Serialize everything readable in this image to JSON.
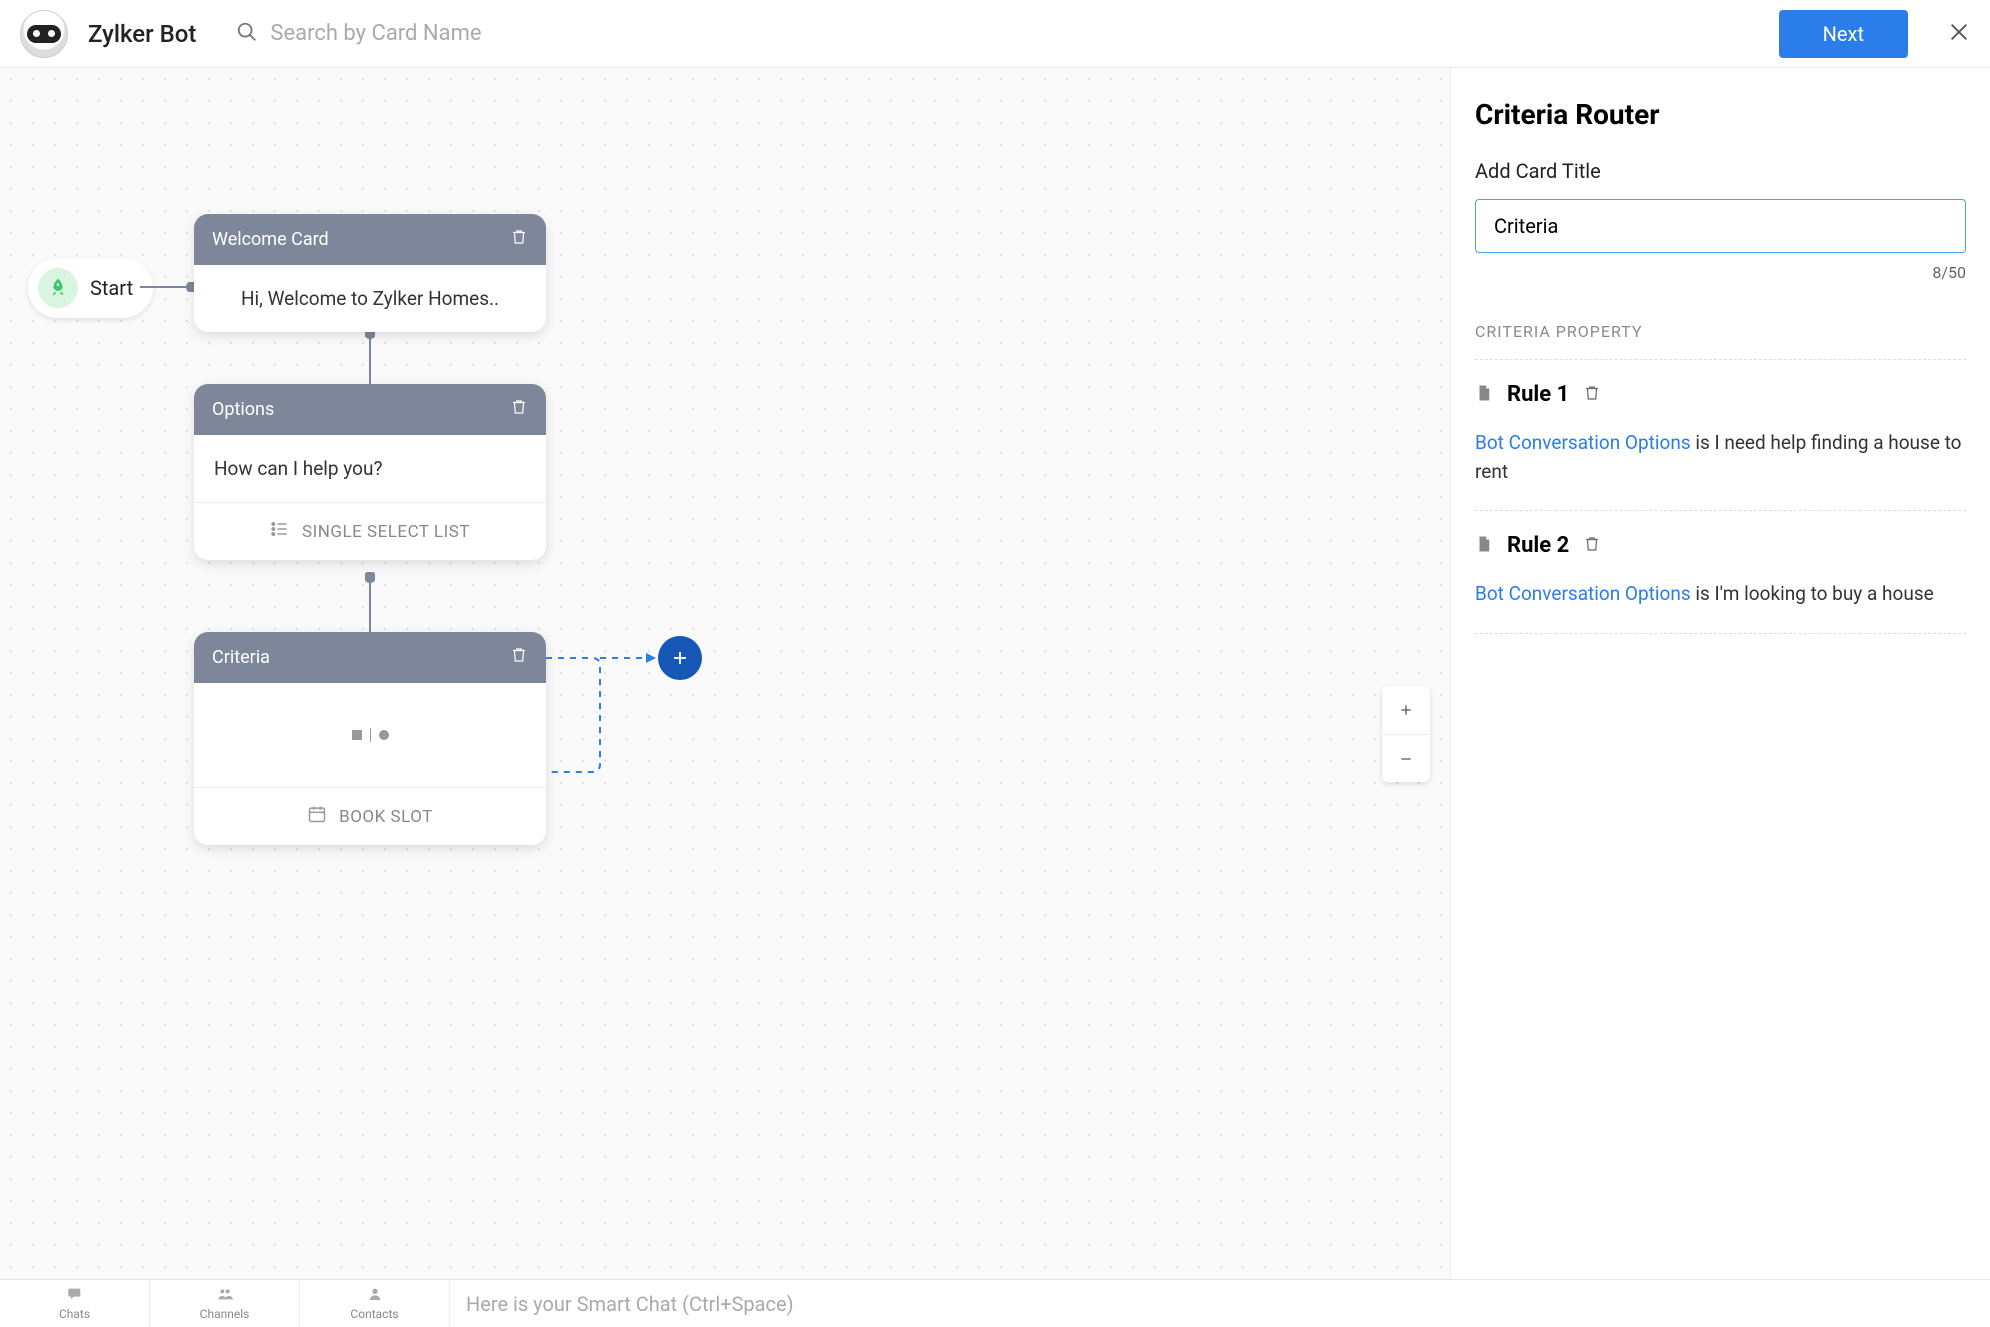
{
  "header": {
    "bot_name": "Zylker Bot",
    "search_placeholder": "Search by Card Name",
    "next_label": "Next"
  },
  "canvas": {
    "start_label": "Start",
    "cards": {
      "welcome": {
        "title": "Welcome Card",
        "body": "Hi, Welcome to Zylker Homes.."
      },
      "options": {
        "title": "Options",
        "body": "How can I help you?",
        "footer": "SINGLE SELECT LIST"
      },
      "criteria": {
        "title": "Criteria",
        "footer": "BOOK SLOT"
      }
    }
  },
  "panel": {
    "title": "Criteria Router",
    "field_label": "Add Card Title",
    "title_value": "Criteria",
    "char_counter": "8/50",
    "section_label": "CRITERIA PROPERTY",
    "rules": [
      {
        "name": "Rule 1",
        "link": "Bot Conversation Options",
        "text": " is I need help finding a house to rent"
      },
      {
        "name": "Rule 2",
        "link": "Bot Conversation Options",
        "text": " is I'm looking to buy a house"
      }
    ]
  },
  "bottombar": {
    "tabs": [
      "Chats",
      "Channels",
      "Contacts"
    ],
    "smart_chat_placeholder": "Here is your Smart Chat (Ctrl+Space)"
  }
}
